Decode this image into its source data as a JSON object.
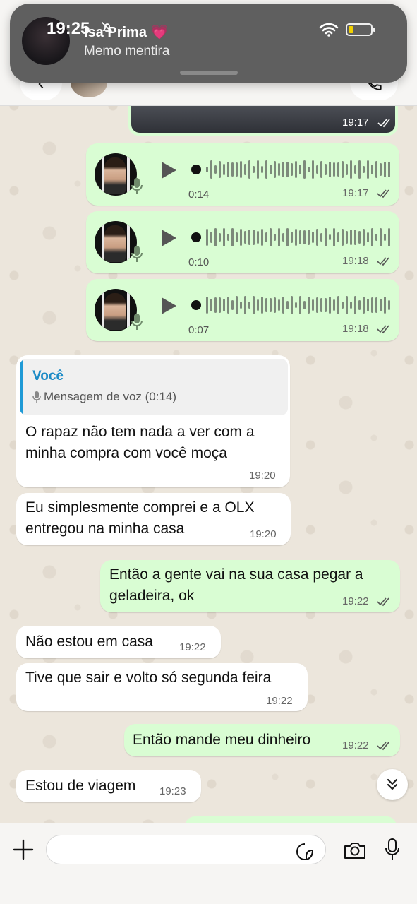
{
  "status_bar": {
    "time": "19:25"
  },
  "notification": {
    "sender": "Isa Prima",
    "sender_emoji": "💗",
    "message": "Memo mentira"
  },
  "chat": {
    "contact_name": "Andressa Olx"
  },
  "messages": [
    {
      "id": "m0",
      "type": "image",
      "direction": "out",
      "time": "19:17"
    },
    {
      "id": "m1",
      "type": "voice",
      "direction": "out",
      "duration": "0:14",
      "time": "19:17"
    },
    {
      "id": "m2",
      "type": "voice",
      "direction": "out",
      "duration": "0:10",
      "time": "19:18"
    },
    {
      "id": "m3",
      "type": "voice",
      "direction": "out",
      "duration": "0:07",
      "time": "19:18"
    },
    {
      "id": "m4",
      "type": "text",
      "direction": "in",
      "reply_to": {
        "author": "Você",
        "text": "Mensagem de voz (0:14)"
      },
      "line1": "O rapaz não tem nada a ver com a",
      "line2": "minha compra com você moça",
      "time": "19:20"
    },
    {
      "id": "m5",
      "type": "text",
      "direction": "in",
      "line1": "Eu simplesmente comprei e a OLX",
      "line2": "entregou na minha casa",
      "time": "19:20"
    },
    {
      "id": "m6",
      "type": "text",
      "direction": "out",
      "line1": "Então a gente vai na sua casa pegar a",
      "line2": "geladeira, ok",
      "time": "19:22"
    },
    {
      "id": "m7",
      "type": "text",
      "direction": "in",
      "line1": "Não estou em casa",
      "time": "19:22"
    },
    {
      "id": "m8",
      "type": "text",
      "direction": "in",
      "line1": "Tive que sair e volto só segunda feira",
      "time": "19:22"
    },
    {
      "id": "m9",
      "type": "text",
      "direction": "out",
      "line1": "Então mande meu dinheiro",
      "time": "19:22"
    },
    {
      "id": "m10",
      "type": "text",
      "direction": "in",
      "line1": "Estou de viagem",
      "time": "19:23"
    }
  ],
  "icons": {
    "plus": "plus-icon",
    "sticker": "sticker-icon",
    "camera": "camera-icon",
    "mic": "mic-icon",
    "scroll_down": "chevron-double-down-icon",
    "read_ticks": "double-check-icon"
  },
  "colors": {
    "outgoing": "#d9fdd3",
    "incoming": "#ffffff",
    "quote_accent": "#1f9ad6",
    "background": "#efeae2"
  }
}
